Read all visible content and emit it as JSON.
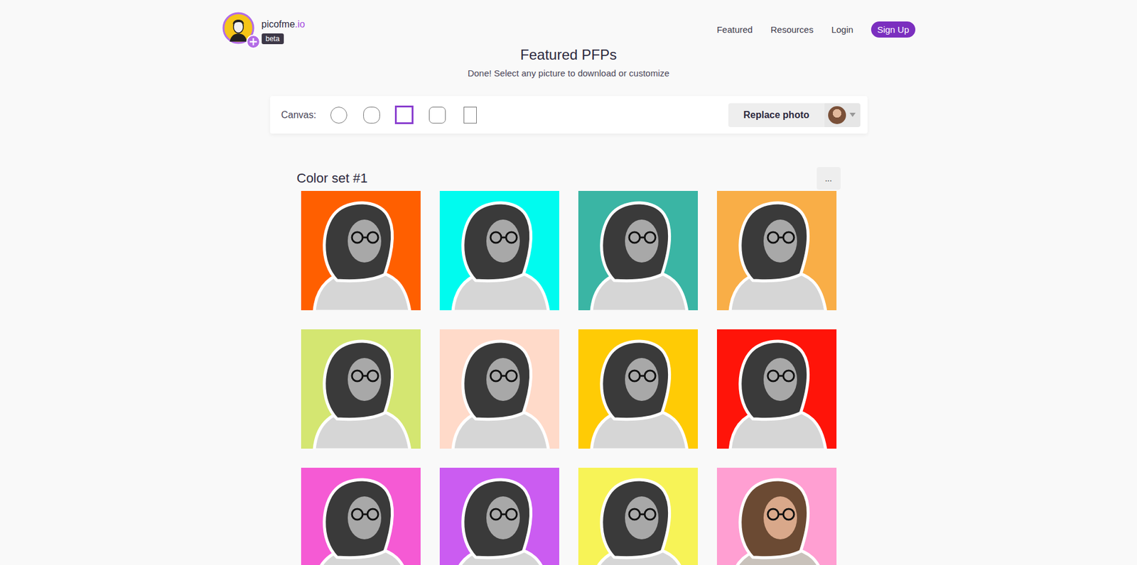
{
  "brand": {
    "name": "picofme",
    "suffix": ".io",
    "badge": "beta"
  },
  "nav": [
    {
      "label": "Featured",
      "kind": "link"
    },
    {
      "label": "Resources",
      "kind": "link"
    },
    {
      "label": "Login",
      "kind": "link"
    },
    {
      "label": "Sign Up",
      "kind": "button"
    }
  ],
  "page": {
    "title": "Featured PFPs",
    "subtitle": "Done! Select any picture to download or customize"
  },
  "toolbar": {
    "label": "Canvas:",
    "shapes": [
      {
        "kind": "circle",
        "selected": false
      },
      {
        "kind": "squircle",
        "selected": false
      },
      {
        "kind": "square",
        "selected": true
      },
      {
        "kind": "rounded",
        "selected": false
      },
      {
        "kind": "portrait",
        "selected": false
      }
    ],
    "replace_button": "Replace photo"
  },
  "color_sets": [
    {
      "title": "Color set #1",
      "menu": "...",
      "tiles": [
        {
          "color": "#ff5f00",
          "kind": "grayscale"
        },
        {
          "color": "#00fbef",
          "kind": "grayscale"
        },
        {
          "color": "#3ab5a4",
          "kind": "grayscale"
        },
        {
          "color": "#f9ae47",
          "kind": "grayscale"
        },
        {
          "color": "#d4e671",
          "kind": "grayscale"
        },
        {
          "color": "#ffdac9",
          "kind": "grayscale"
        },
        {
          "color": "#ffcb05",
          "kind": "grayscale"
        },
        {
          "color": "#ff1409",
          "kind": "grayscale"
        },
        {
          "color": "#f55ad4",
          "kind": "grayscale"
        },
        {
          "color": "#cb5cf1",
          "kind": "grayscale"
        },
        {
          "color": "#f7f357",
          "kind": "grayscale"
        },
        {
          "color": "#ff9fd2",
          "kind": "color"
        }
      ]
    }
  ]
}
